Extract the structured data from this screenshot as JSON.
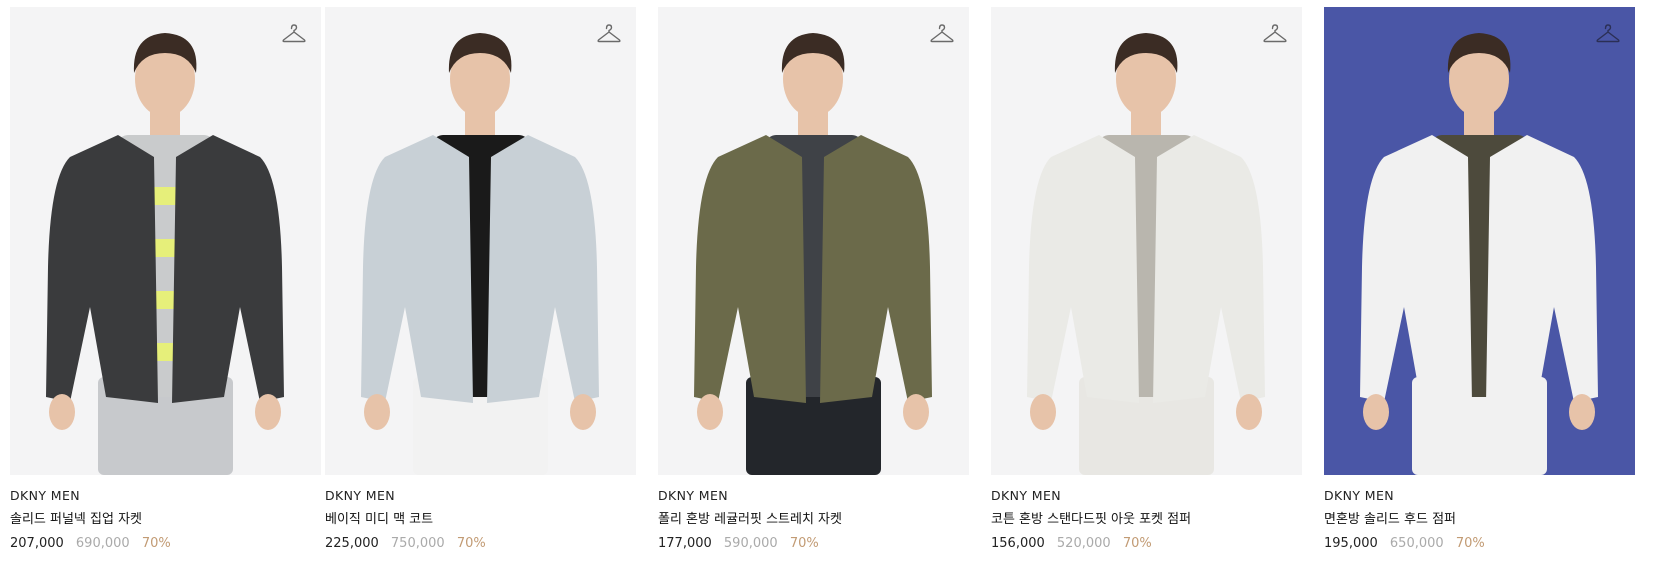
{
  "colors": {
    "photo_bg_default": "#f4f4f5",
    "photo_bg_blue": "#4a56a6",
    "discount": "#c29b74",
    "original_price": "#aaaaaa"
  },
  "wishlist_icon": "hanger-icon",
  "products": [
    {
      "brand": "DKNY MEN",
      "name": "솔리드 퍼널넥 집업 자켓",
      "sale_price": "207,000",
      "original_price": "690,000",
      "discount": "70%",
      "photo_bg": "#f4f4f5",
      "jacket_color": "#3a3b3d",
      "inner_color": "#c9cbcc",
      "accent_color": "#e6ef7a",
      "pants_color": "#c7c9cc"
    },
    {
      "brand": "DKNY MEN",
      "name": "베이직 미디 맥 코트",
      "sale_price": "225,000",
      "original_price": "750,000",
      "discount": "70%",
      "photo_bg": "#f4f4f5",
      "jacket_color": "#c8d0d6",
      "inner_color": "#1a1a1a",
      "accent_color": "#1a1a1a",
      "pants_color": "#f2f2f2"
    },
    {
      "brand": "DKNY MEN",
      "name": "폴리 혼방 레귤러핏 스트레치 자켓",
      "sale_price": "177,000",
      "original_price": "590,000",
      "discount": "70%",
      "photo_bg": "#f4f4f5",
      "jacket_color": "#6b6a4a",
      "inner_color": "#3f4247",
      "accent_color": "#3f4247",
      "pants_color": "#23262b"
    },
    {
      "brand": "DKNY MEN",
      "name": "코튼 혼방 스탠다드핏 아웃 포켓 점퍼",
      "sale_price": "156,000",
      "original_price": "520,000",
      "discount": "70%",
      "photo_bg": "#f4f4f5",
      "jacket_color": "#eaeae6",
      "inner_color": "#b9b6ae",
      "accent_color": "#b9b6ae",
      "pants_color": "#e8e7e3"
    },
    {
      "brand": "DKNY MEN",
      "name": "면혼방 솔리드 후드 점퍼",
      "sale_price": "195,000",
      "original_price": "650,000",
      "discount": "70%",
      "photo_bg": "#4a56a6",
      "jacket_color": "#f1f1f1",
      "inner_color": "#4d4a3c",
      "accent_color": "#4d4a3c",
      "pants_color": "#f1f1f1"
    }
  ]
}
